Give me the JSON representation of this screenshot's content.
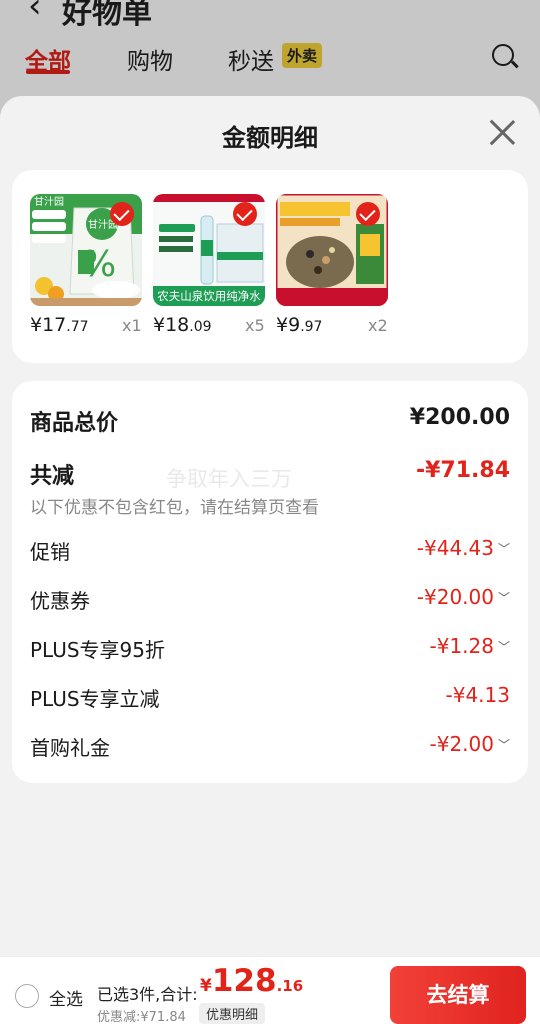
{
  "background_page": {
    "title": "好物单",
    "tabs": [
      {
        "label": "全部",
        "active": true
      },
      {
        "label": "购物",
        "active": false
      },
      {
        "label": "秒送",
        "active": false
      }
    ],
    "badge": "外卖"
  },
  "sheet": {
    "title": "金额明细"
  },
  "products": [
    {
      "price_int": "¥17",
      "price_dec": ".77",
      "qty": "x1",
      "image_name": "ganzhiyuan-sugar-product"
    },
    {
      "price_int": "¥18",
      "price_dec": ".09",
      "qty": "x5",
      "image_name": "nongfu-spring-water-product",
      "caption": "农夫山泉饮用纯净水"
    },
    {
      "price_int": "¥9",
      "price_dec": ".97",
      "qty": "x2",
      "image_name": "mixed-grain-rice-product"
    }
  ],
  "amount": {
    "total_label": "商品总价",
    "total_value": "¥200.00",
    "reduce_label": "共减",
    "reduce_value": "-¥71.84",
    "note": "以下优惠不包含红包，请在结算页查看",
    "watermark": "争取年入三万",
    "items": [
      {
        "label": "促销",
        "value": "-¥44.43",
        "expandable": true
      },
      {
        "label": "优惠券",
        "value": "-¥20.00",
        "expandable": true
      },
      {
        "label": "PLUS专享95折",
        "value": "-¥1.28",
        "expandable": true
      },
      {
        "label": "PLUS专享立减",
        "value": "-¥4.13",
        "expandable": false
      },
      {
        "label": "首购礼金",
        "value": "-¥2.00",
        "expandable": true
      }
    ]
  },
  "bottom_bar": {
    "select_all": "全选",
    "selected": "已选3件,合计:",
    "total_currency": "¥",
    "total_int": "128",
    "total_dec": ".16",
    "discount": "优惠减:¥71.84",
    "detail_button": "优惠明细",
    "checkout_button": "去结算"
  },
  "colors": {
    "accent_red": "#e2231a",
    "badge_yellow": "#f5d43a",
    "sheet_bg": "#f2f2f2"
  }
}
